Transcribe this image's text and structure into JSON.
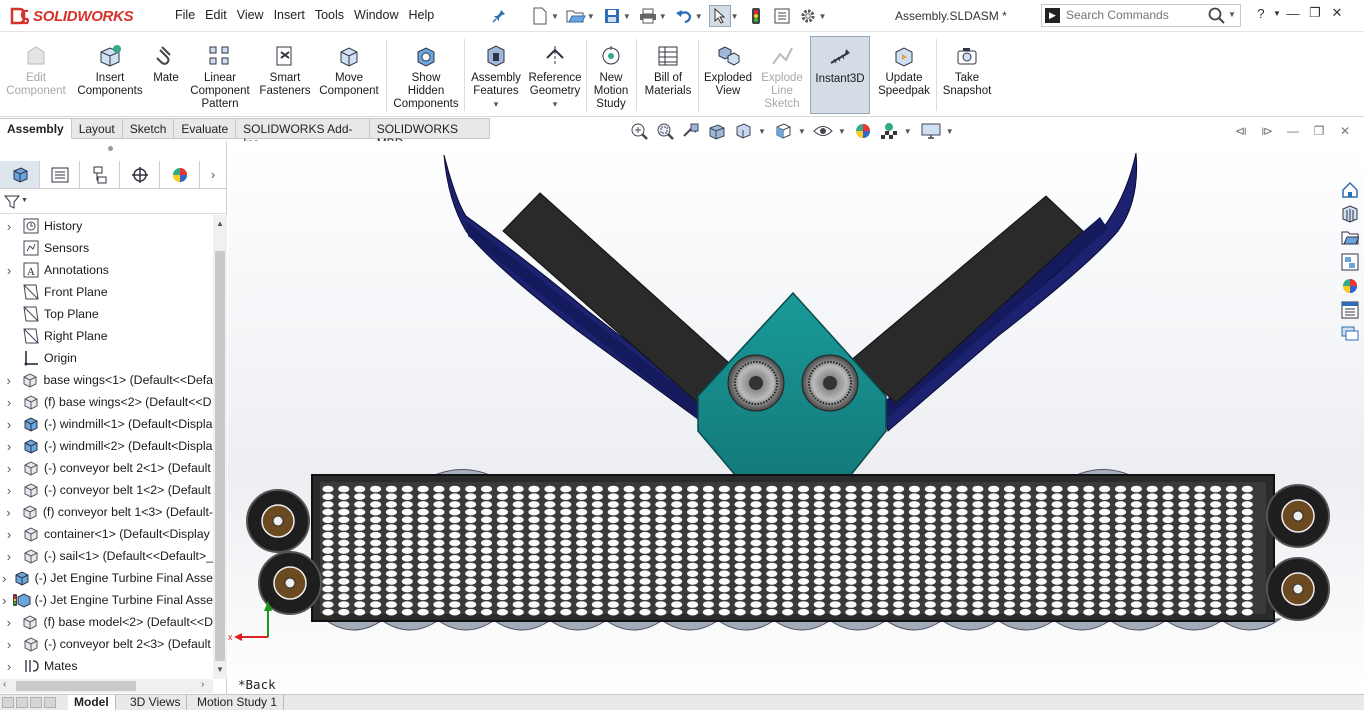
{
  "app": {
    "name": "SOLIDWORKS",
    "document_title": "Assembly.SLDASM *"
  },
  "menu": [
    "File",
    "Edit",
    "View",
    "Insert",
    "Tools",
    "Window",
    "Help"
  ],
  "search": {
    "placeholder": "Search Commands"
  },
  "ribbon": {
    "buttons": [
      {
        "id": "edit-component",
        "lines": [
          "Edit",
          "Component"
        ],
        "disabled": true
      },
      {
        "id": "insert-components",
        "lines": [
          "Insert",
          "Components"
        ]
      },
      {
        "id": "mate",
        "lines": [
          "Mate"
        ]
      },
      {
        "id": "linear-component-pattern",
        "lines": [
          "Linear",
          "Component",
          "Pattern"
        ]
      },
      {
        "id": "smart-fasteners",
        "lines": [
          "Smart",
          "Fasteners"
        ]
      },
      {
        "id": "move-component",
        "lines": [
          "Move",
          "Component"
        ]
      },
      {
        "id": "show-hidden-components",
        "lines": [
          "Show",
          "Hidden",
          "Components"
        ]
      },
      {
        "id": "assembly-features",
        "lines": [
          "Assembly",
          "Features"
        ]
      },
      {
        "id": "reference-geometry",
        "lines": [
          "Reference",
          "Geometry"
        ]
      },
      {
        "id": "new-motion-study",
        "lines": [
          "New",
          "Motion",
          "Study"
        ]
      },
      {
        "id": "bill-of-materials",
        "lines": [
          "Bill of",
          "Materials"
        ]
      },
      {
        "id": "exploded-view",
        "lines": [
          "Exploded",
          "View"
        ]
      },
      {
        "id": "explode-line-sketch",
        "lines": [
          "Explode",
          "Line",
          "Sketch"
        ],
        "disabled": true
      },
      {
        "id": "instant3d",
        "lines": [
          "Instant3D"
        ],
        "active": true
      },
      {
        "id": "update-speedpak",
        "lines": [
          "Update",
          "Speedpak"
        ]
      },
      {
        "id": "take-snapshot",
        "lines": [
          "Take",
          "Snapshot"
        ]
      }
    ]
  },
  "command_tabs": [
    "Assembly",
    "Layout",
    "Sketch",
    "Evaluate",
    "SOLIDWORKS Add-Ins",
    "SOLIDWORKS MBD"
  ],
  "active_command_tab": "Assembly",
  "feature_tree": [
    {
      "label": "History",
      "icon": "history-icon",
      "expand": true
    },
    {
      "label": "Sensors",
      "icon": "sensors-icon",
      "expand": false
    },
    {
      "label": "Annotations",
      "icon": "annotations-icon",
      "expand": true
    },
    {
      "label": "Front Plane",
      "icon": "plane-icon",
      "expand": false
    },
    {
      "label": "Top Plane",
      "icon": "plane-icon",
      "expand": false
    },
    {
      "label": "Right Plane",
      "icon": "plane-icon",
      "expand": false
    },
    {
      "label": "Origin",
      "icon": "origin-icon",
      "expand": false
    },
    {
      "label": "base wings<1> (Default<<Defa",
      "icon": "part-icon",
      "expand": true
    },
    {
      "label": "(f) base wings<2> (Default<<D",
      "icon": "part-icon",
      "expand": true
    },
    {
      "label": "(-) windmill<1> (Default<Displa",
      "icon": "assembly-icon",
      "expand": true
    },
    {
      "label": "(-) windmill<2> (Default<Displa",
      "icon": "assembly-icon",
      "expand": true
    },
    {
      "label": "(-) conveyor belt 2<1> (Default",
      "icon": "part-icon",
      "expand": true
    },
    {
      "label": "(-) conveyor belt 1<2> (Default",
      "icon": "part-icon",
      "expand": true
    },
    {
      "label": "(f) conveyor belt 1<3> (Default-",
      "icon": "part-icon",
      "expand": true
    },
    {
      "label": "container<1> (Default<Display",
      "icon": "part-icon",
      "expand": true
    },
    {
      "label": "(-) sail<1> (Default<<Default>_",
      "icon": "part-icon",
      "expand": true
    },
    {
      "label": "(-) Jet Engine Turbine Final Asse",
      "icon": "assembly-icon",
      "expand": true
    },
    {
      "label": "(-) Jet Engine Turbine Final Asse",
      "icon": "assembly-warning-icon",
      "expand": true
    },
    {
      "label": "(f) base model<2> (Default<<D",
      "icon": "part-icon",
      "expand": true
    },
    {
      "label": "(-) conveyor belt 2<3> (Default",
      "icon": "part-icon",
      "expand": true
    },
    {
      "label": "Mates",
      "icon": "mates-icon",
      "expand": true
    }
  ],
  "viewport": {
    "view_label": "*Back"
  },
  "bottom_tabs": [
    "Model",
    "3D Views",
    "Motion Study 1"
  ],
  "active_bottom_tab": "Model",
  "colors": {
    "brand_red": "#d6322c",
    "wing_blue": "#1c2270",
    "teal_body": "#168a8a",
    "panel_dark": "#2a2a2a"
  }
}
